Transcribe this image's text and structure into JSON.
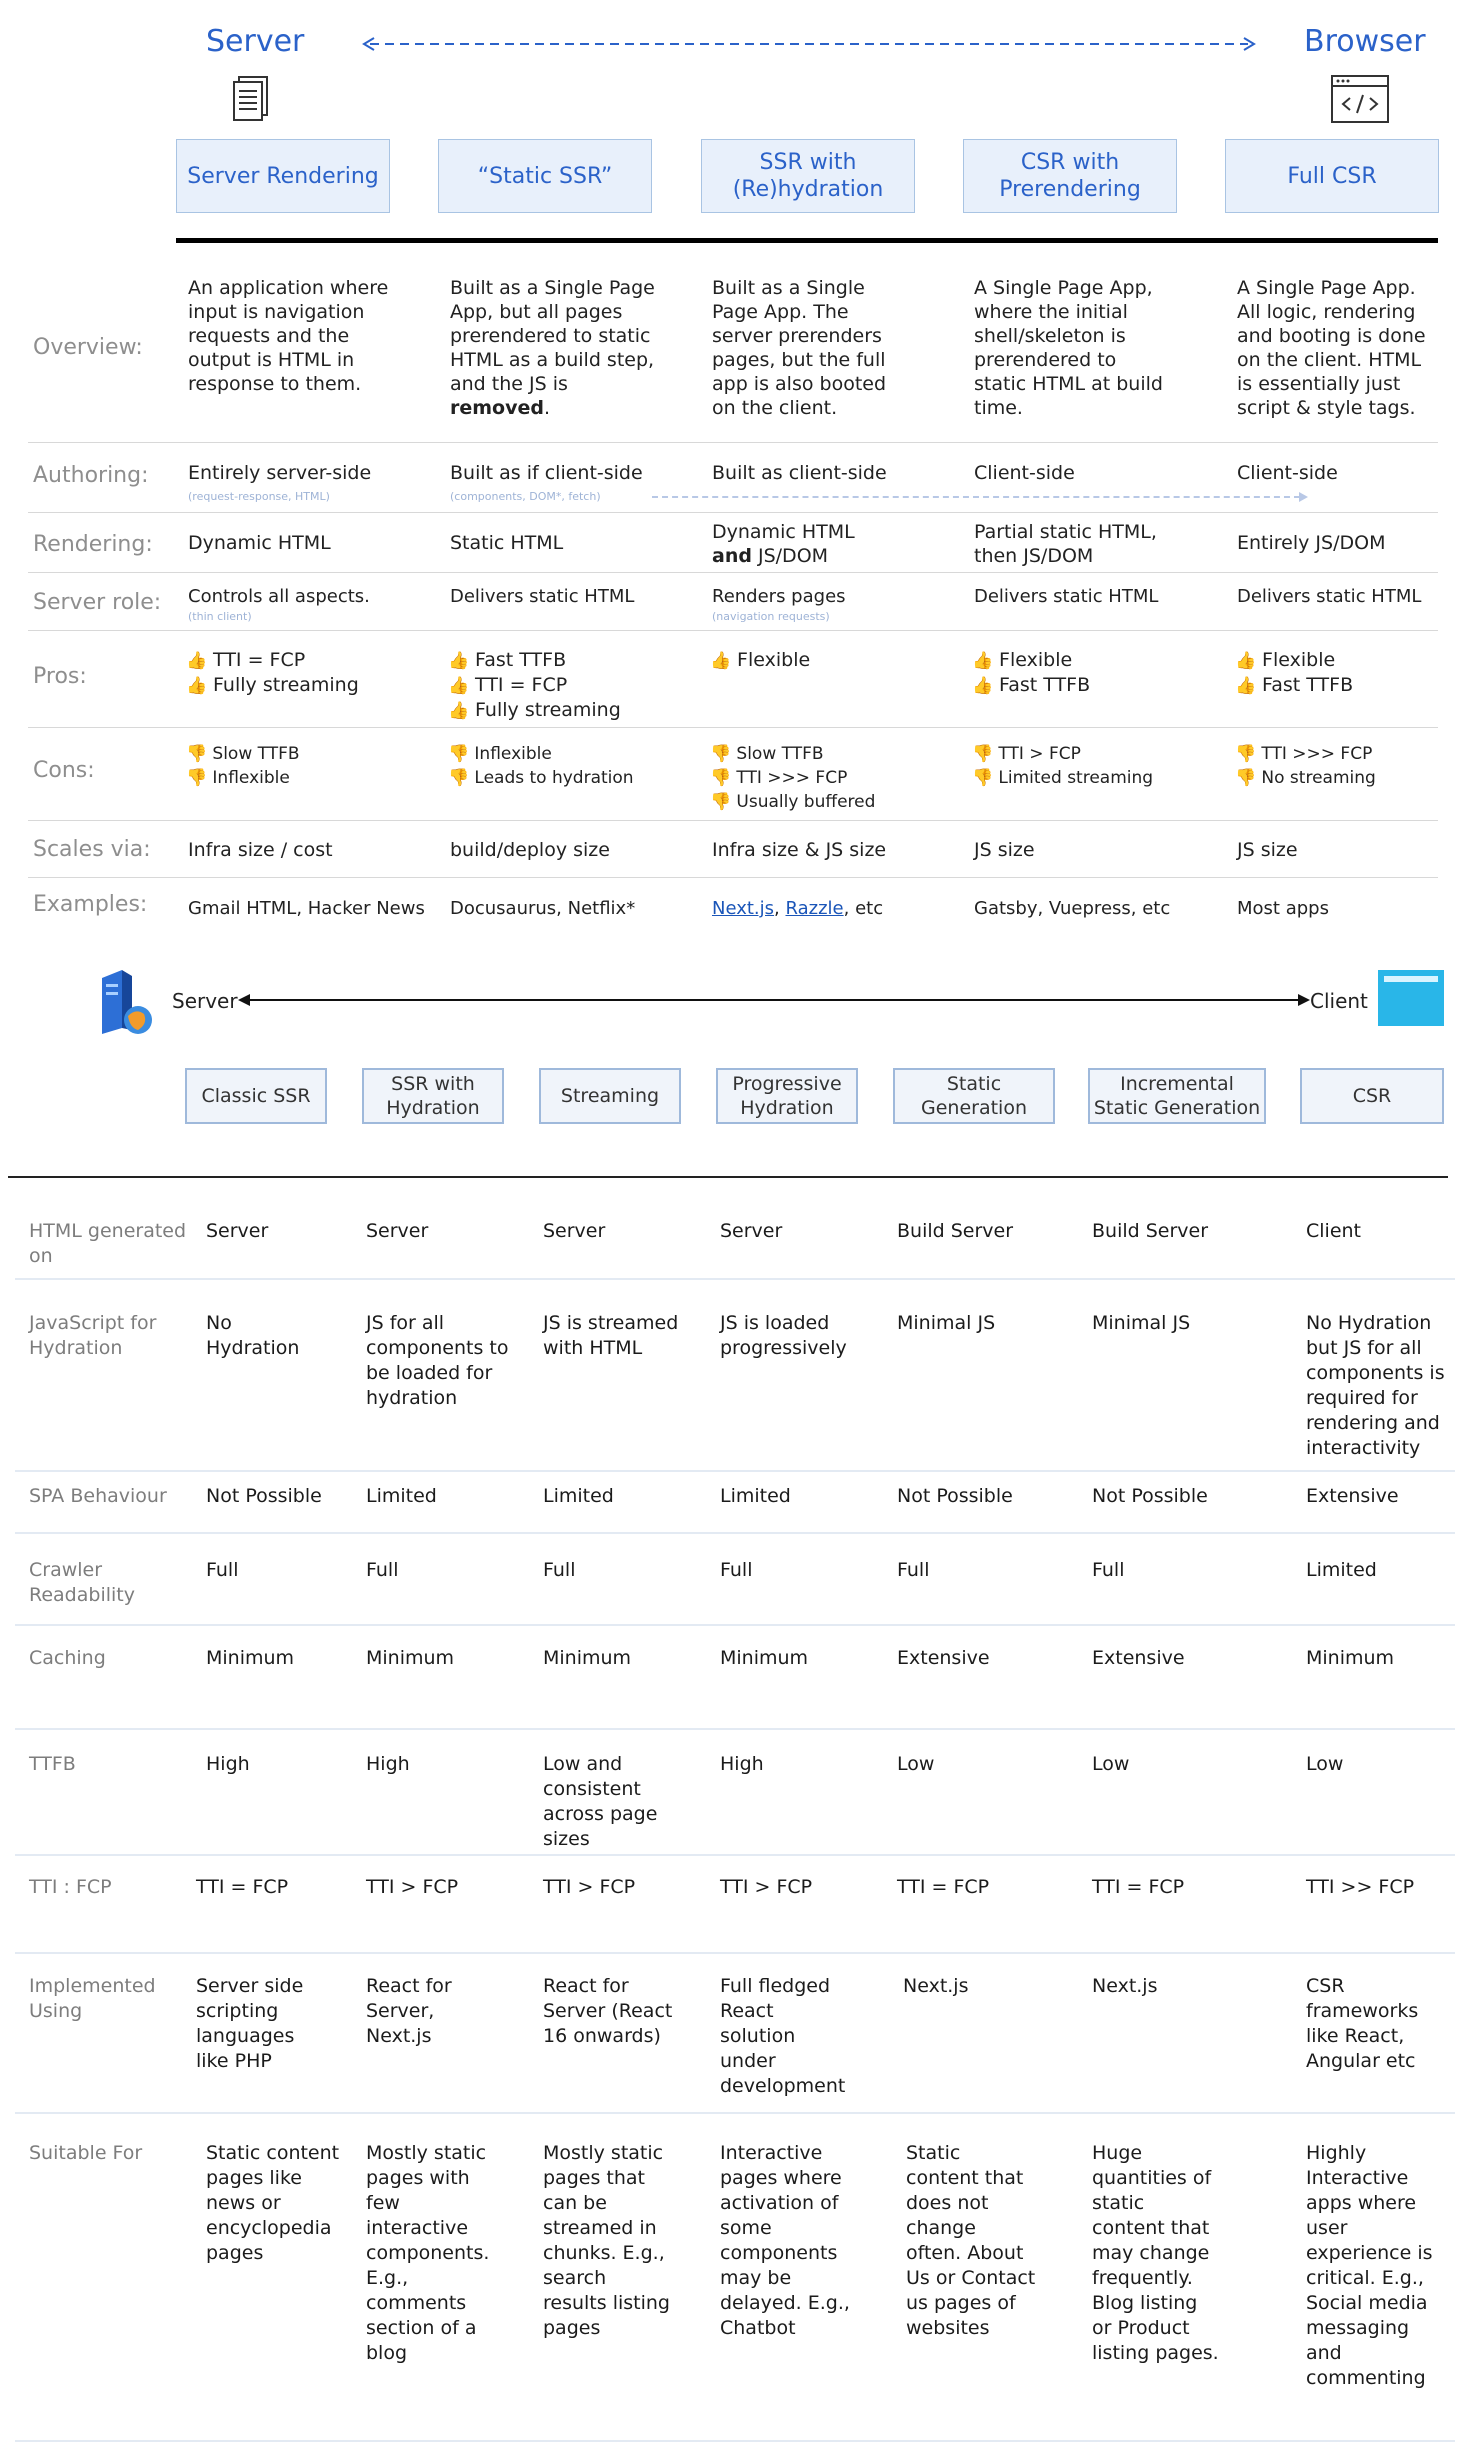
{
  "top": {
    "server_heading": "Server",
    "browser_heading": "Browser",
    "columns": [
      "Server Rendering",
      "“Static SSR”",
      "SSR with (Re)hydration",
      "CSR with Prerendering",
      "Full CSR"
    ],
    "rows": {
      "overview": {
        "label": "Overview:",
        "cells": [
          "An application where input is navigation requests and the output is HTML in response to them.",
          "Built as a Single Page App, but all pages prerendered to static HTML as a build step, and the JS is ",
          "Built as a Single Page App. The server prerenders pages, but the full app is also booted on the client.",
          "A Single Page App, where the initial shell/skeleton is prerendered to static HTML at build time.",
          "A Single Page App. All logic, rendering and booting is done on the client. HTML is essentially just script & style tags."
        ],
        "removed_word": "removed",
        "removed_suffix": "."
      },
      "authoring": {
        "label": "Authoring:",
        "cells": [
          "Entirely server-side",
          "Built as if client-side",
          "Built as client-side",
          "Client-side",
          "Client-side"
        ],
        "subs": [
          "(request-response, HTML)",
          "(components, DOM*, fetch)"
        ]
      },
      "rendering": {
        "label": "Rendering:",
        "cells": [
          "Dynamic HTML",
          "Static HTML",
          "Dynamic HTML",
          "Partial static HTML, then JS/DOM",
          "Entirely JS/DOM"
        ],
        "and_word": "and",
        "and_suffix": " JS/DOM"
      },
      "server_role": {
        "label": "Server role:",
        "cells": [
          "Controls all aspects.",
          "Delivers static HTML",
          "Renders pages",
          "Delivers static HTML",
          "Delivers static HTML"
        ],
        "subs": [
          "(thin client)",
          "(navigation requests)"
        ]
      },
      "pros": {
        "label": "Pros:",
        "cells": [
          [
            "TTI = FCP",
            "Fully streaming"
          ],
          [
            "Fast TTFB",
            "TTI = FCP",
            "Fully streaming"
          ],
          [
            "Flexible"
          ],
          [
            "Flexible",
            "Fast TTFB"
          ],
          [
            "Flexible",
            "Fast TTFB"
          ]
        ],
        "emoji": "👍"
      },
      "cons": {
        "label": "Cons:",
        "cells": [
          [
            "Slow TTFB",
            "Inflexible"
          ],
          [
            "Inflexible",
            "Leads to hydration"
          ],
          [
            "Slow TTFB",
            "TTI >>> FCP",
            "Usually buffered"
          ],
          [
            "TTI > FCP",
            "Limited streaming"
          ],
          [
            "TTI >>> FCP",
            "No streaming"
          ]
        ],
        "emoji": "👎"
      },
      "scales": {
        "label": "Scales via:",
        "cells": [
          "Infra size / cost",
          "build/deploy size",
          "Infra size & JS size",
          "JS size",
          "JS size"
        ]
      },
      "examples": {
        "label": "Examples:",
        "cells": [
          "Gmail HTML, Hacker News",
          "Docusaurus, Netflix*",
          "",
          "Gatsby, Vuepress, etc",
          "Most apps"
        ],
        "link1": "Next.js",
        "link2": "Razzle",
        "sep1": ", ",
        "sep2": ", etc"
      }
    }
  },
  "middle": {
    "server_label": "Server",
    "client_label": "Client",
    "boxes": [
      "Classic SSR",
      "SSR with Hydration",
      "Streaming",
      "Progressive Hydration",
      "Static Generation",
      "Incremental Static Generation",
      "CSR"
    ]
  },
  "bottom": {
    "rows": [
      {
        "label": "HTML generated on",
        "cells": [
          "Server",
          "Server",
          "Server",
          "Server",
          "Build Server",
          "Build Server",
          "Client"
        ]
      },
      {
        "label": "JavaScript for Hydration",
        "cells": [
          "No Hydration",
          "JS for all components to be loaded for hydration",
          "JS is streamed with HTML",
          "JS is loaded progressively",
          "Minimal JS",
          "Minimal JS",
          "No Hydration but JS for all components is required for rendering and interactivity"
        ]
      },
      {
        "label": "SPA Behaviour",
        "cells": [
          "Not Possible",
          "Limited",
          "Limited",
          "Limited",
          "Not Possible",
          "Not Possible",
          "Extensive"
        ]
      },
      {
        "label": "Crawler Readability",
        "cells": [
          "Full",
          "Full",
          "Full",
          "Full",
          "Full",
          "Full",
          "Limited"
        ]
      },
      {
        "label": "Caching",
        "cells": [
          "Minimum",
          "Minimum",
          "Minimum",
          "Minimum",
          "Extensive",
          "Extensive",
          "Minimum"
        ]
      },
      {
        "label": "TTFB",
        "cells": [
          "High",
          "High",
          "Low and consistent across page sizes",
          "High",
          "Low",
          "Low",
          "Low"
        ]
      },
      {
        "label": "TTI : FCP",
        "cells": [
          "TTI = FCP",
          "TTI > FCP",
          "TTI > FCP",
          "TTI > FCP",
          "TTI = FCP",
          "TTI = FCP",
          "TTI >> FCP"
        ]
      },
      {
        "label": "Implemented Using",
        "cells": [
          "Server side scripting languages like PHP",
          "React for Server, Next.js",
          "React for Server (React 16 onwards)",
          "Full fledged React solution under development",
          "Next.js",
          "Next.js",
          "CSR frameworks like React, Angular etc"
        ]
      },
      {
        "label": "Suitable For",
        "cells": [
          "Static content pages like news or encyclopedia pages",
          "Mostly static pages with few interactive components. E.g., comments section of a blog",
          "Mostly static pages that can be streamed in chunks. E.g., search results listing pages",
          "Interactive pages where activation of some components may be delayed. E.g., Chatbot",
          "Static content that does not change often. About Us or Contact us pages of websites",
          "Huge quantities of static content that may change frequently. Blog listing or Product listing pages.",
          "Highly Interactive apps where user experience is critical. E.g., Social media messaging and commenting"
        ]
      }
    ]
  }
}
